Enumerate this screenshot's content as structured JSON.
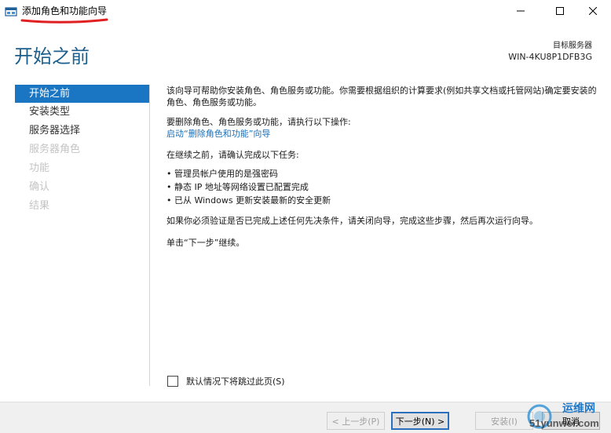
{
  "window": {
    "title": "添加角色和功能向导",
    "minimize_icon": "minimize-icon",
    "maximize_icon": "maximize-icon",
    "close_icon": "close-icon",
    "annotation_color": "#e02020"
  },
  "header": {
    "page_title": "开始之前",
    "target_label": "目标服务器",
    "target_name": "WIN-4KU8P1DFB3G"
  },
  "sidebar": {
    "items": [
      {
        "label": "开始之前",
        "state": "active"
      },
      {
        "label": "安装类型",
        "state": "enabled"
      },
      {
        "label": "服务器选择",
        "state": "enabled"
      },
      {
        "label": "服务器角色",
        "state": "disabled"
      },
      {
        "label": "功能",
        "state": "disabled"
      },
      {
        "label": "确认",
        "state": "disabled"
      },
      {
        "label": "结果",
        "state": "disabled"
      }
    ]
  },
  "content": {
    "intro": "该向导可帮助你安装角色、角色服务或功能。你需要根据组织的计算要求(例如共享文档或托管网站)确定要安装的角色、角色服务或功能。",
    "remove_text": "要删除角色、角色服务或功能，请执行以下操作:",
    "remove_link": "启动“删除角色和功能”向导",
    "confirm_text": "在继续之前，请确认完成以下任务:",
    "tasks": [
      "管理员帐户使用的是强密码",
      "静态 IP 地址等网络设置已配置完成",
      "已从 Windows 更新安装最新的安全更新"
    ],
    "verify_text": "如果你必须验证是否已完成上述任何先决条件，请关闭向导，完成这些步骤，然后再次运行向导。",
    "next_text": "单击“下一步”继续。"
  },
  "skip_checkbox": {
    "label": "默认情况下将跳过此页(S)",
    "checked": false
  },
  "footer": {
    "prev_label": "< 上一步(P)",
    "next_label": "下一步(N) >",
    "install_label": "安装(I)",
    "cancel_label": "取消"
  },
  "watermark": {
    "top_text": "运维网",
    "bottom_text": "51yunwei.com"
  },
  "colors": {
    "accent": "#1a75c2",
    "title_blue": "#1c5f8c",
    "link": "#1a6fb8"
  }
}
